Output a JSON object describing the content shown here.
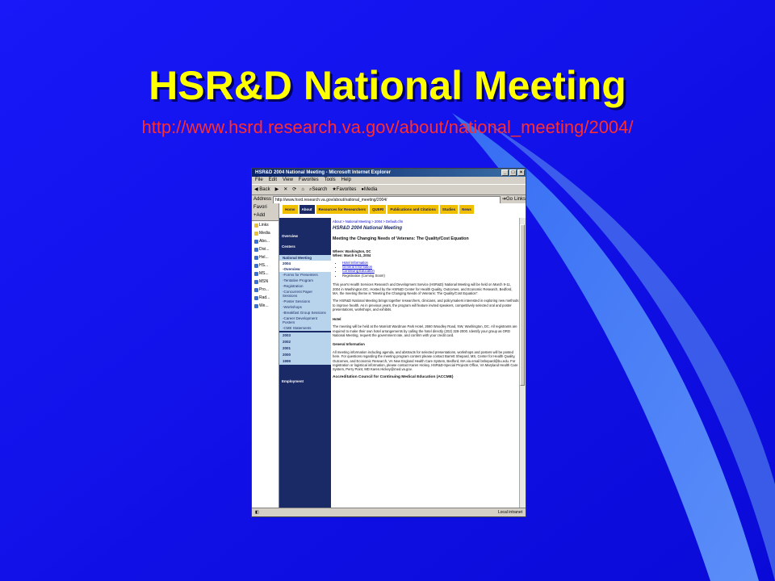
{
  "slide": {
    "title": "HSR&D National Meeting",
    "url": "http://www.hsrd.research.va.gov/about/national_meeting/2004/"
  },
  "window": {
    "title": "HSR&D 2004 National Meeting - Microsoft Internet Explorer",
    "menu": [
      "File",
      "Edit",
      "View",
      "Favorites",
      "Tools",
      "Help"
    ],
    "toolbar": [
      "Back",
      "Search",
      "Favorites",
      "Media"
    ],
    "address_label": "Address",
    "address_value": "http://www.hsrd.research.va.gov/about/national_meeting/2004/",
    "go_label": "Go",
    "links_label": "Links",
    "status_text": "Local intranet"
  },
  "favorites": {
    "header": "Favori",
    "add_label": "Add",
    "items": [
      "Links",
      "Media",
      "Abo...",
      "Divi...",
      "Hel...",
      "HS...",
      "MS...",
      "MSN",
      "Pro...",
      "Rad...",
      "We..."
    ]
  },
  "site_tabs": [
    "Home",
    "About",
    "Resources for Researchers",
    "QUERI",
    "Publications and Citations",
    "Studies",
    "News"
  ],
  "left_nav": {
    "overview": "Overview",
    "centers": "Centers",
    "national_meeting": "National Meeting",
    "year": "2004",
    "sub_overview": "-Overview",
    "sub_items": [
      "-Forms for Presenters",
      "-Tentative Program",
      "-Registration",
      "-Concurrent Paper Sessions",
      "-Poster Sessions",
      "-Workshops",
      "-Breakfast Group Sessions",
      "-Career Development Posters",
      "-CME Statements"
    ],
    "years": [
      "2003",
      "2002",
      "2001",
      "2000",
      "1999"
    ],
    "employment": "Employment"
  },
  "content": {
    "breadcrumb": "About > National Meeting > 2004 > Default.cfm",
    "heading": "HSR&D 2004 National Meeting",
    "subheading": "Meeting the Changing Needs of Veterans: The Quality/Cost Equation",
    "where": "Where: Washington, DC",
    "when": "When: March 9-11, 2004",
    "links": [
      "Hotel Information",
      "General Information",
      "Continuing Education"
    ],
    "registration": "Registration (Coming Soon!)",
    "para1": "This year's Health Services Research and Development Service (HSR&D) National Meeting will be held on March 9-11, 2004 in Washington DC. Hosted by the HSR&D Center for Health Quality, Outcomes, and Economic Research, Bedford, MA, the meeting theme is \"Meeting the Changing Needs of Veterans: The Quality/Cost Equation\".",
    "para2": "The HSR&D National Meeting brings together researchers, clinicians, and policymakers interested in exploring new methods to improve health. As in previous years, the program will feature invited speakers, competitively selected oral and poster presentations, workshops, and exhibits.",
    "hotel_heading": "Hotel",
    "hotel_text": "The meeting will be held at the Marriott Wardman Park Hotel, 2660 Woodley Road, NW, Washington, DC. All registrants are required to make their own hotel arrangements by calling the hotel directly (202) 328-2000. Identify your group as ORD National Meeting, request the government rate, and confirm with your credit card.",
    "general_heading": "General Information",
    "general_text": "All meeting information including agenda, and abstracts for selected presentations, workshops and posters will be posted here. For questions regarding the meeting program content please contact Barrett Shepard, MS, Center for Health Quality, Outcomes, and Economic Research, VA New England Health Care System, Bedford, MA via email bshepard@bu.edu. For registration or logistical information, please contact Karen Hickey, HSR&D-Special Projects Office, VA Maryland Health Care System, Perry Point, MD Karen.Hickey@med.va.gov.",
    "accme_heading": "Accreditation Council for Continuing Medical Education (ACCME)"
  },
  "colors": {
    "slide_bg": "#1010f0",
    "title": "#ffff00",
    "url": "#ff2d2d",
    "nav_dark": "#1a2a66",
    "tab_gold": "#f0c000"
  }
}
